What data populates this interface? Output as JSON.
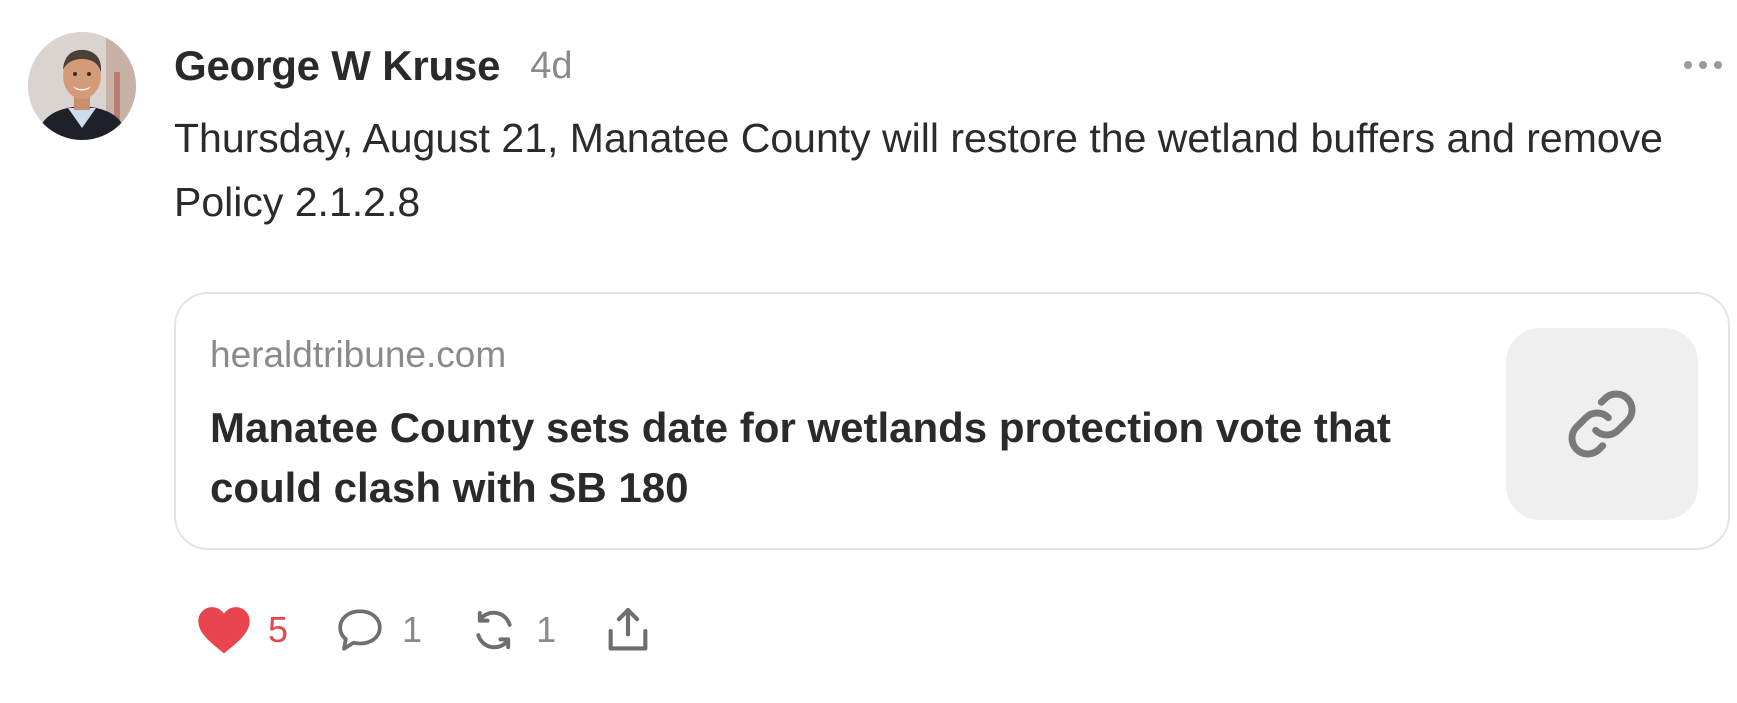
{
  "post": {
    "author": "George W Kruse",
    "timestamp": "4d",
    "text": "Thursday, August 21, Manatee County will restore the wetland buffers and remove Policy 2.1.2.8",
    "more_icon": "ellipsis-icon",
    "avatar": "author-photo"
  },
  "link_preview": {
    "domain": "heraldtribune.com",
    "title": "Manatee County sets date for wetlands protection vote that could clash with SB 180",
    "icon": "link-icon"
  },
  "actions": {
    "like": {
      "icon": "heart-icon",
      "count": "5",
      "color": "#e8454f"
    },
    "reply": {
      "icon": "comment-icon",
      "count": "1"
    },
    "repost": {
      "icon": "repost-icon",
      "count": "1"
    },
    "share": {
      "icon": "share-icon"
    }
  }
}
